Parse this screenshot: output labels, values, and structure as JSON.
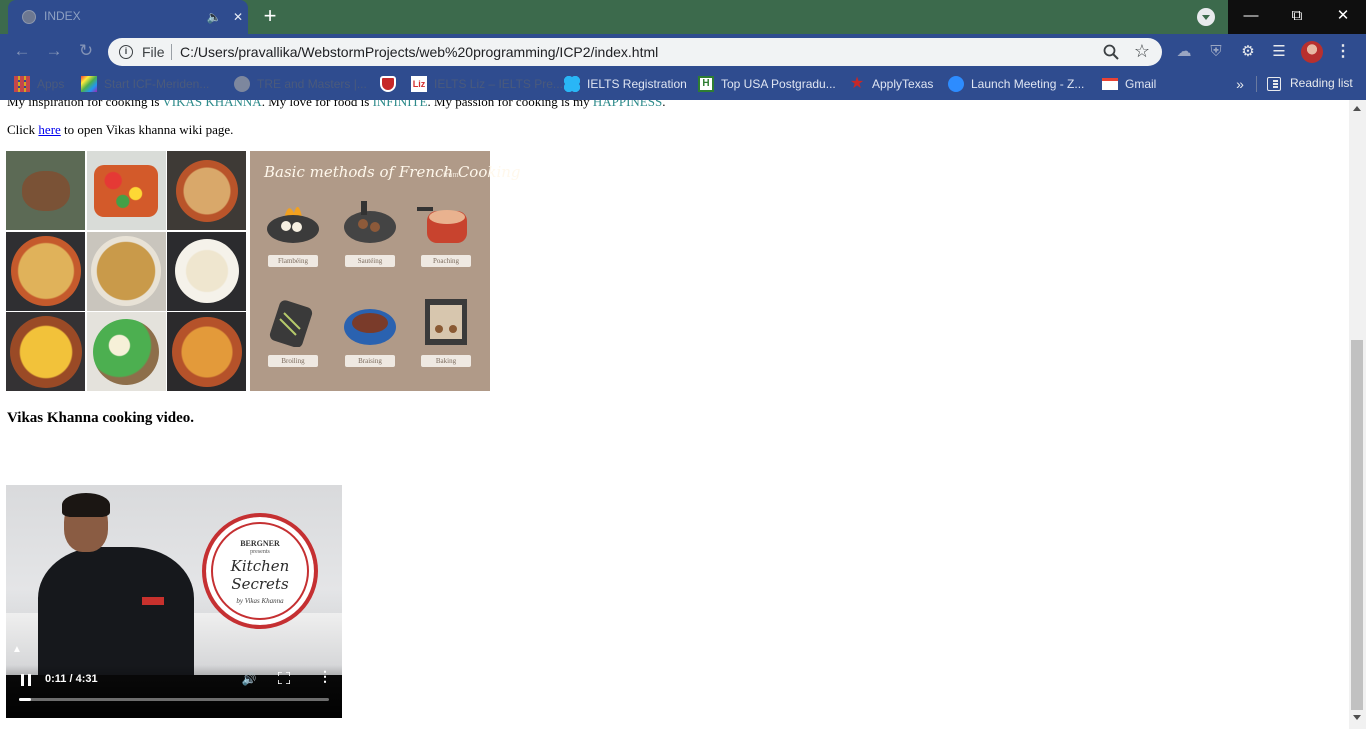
{
  "browser": {
    "tab": {
      "title": "INDEX"
    },
    "address": {
      "scheme_label": "File",
      "url": "C:/Users/pravallika/WebstormProjects/web%20programming/ICP2/index.html"
    },
    "bookmarks": [
      {
        "label": "Apps",
        "dim": true,
        "color": "#e8453c"
      },
      {
        "label": "Start ICF-Meriden...",
        "dim": true,
        "color": "#f4b400"
      },
      {
        "label": "TRE and Masters |...",
        "dim": true,
        "color": "#9aa0a6"
      },
      {
        "label": "",
        "dim": false,
        "color": "#c62828"
      },
      {
        "label": "IELTS Liz – IELTS Pre...",
        "dim": true,
        "color": "#d32f2f"
      },
      {
        "label": "IELTS Registration",
        "dim": false,
        "color": "#29b6f6"
      },
      {
        "label": "Top USA Postgradu...",
        "dim": false,
        "color": "#2e7d32"
      },
      {
        "label": "ApplyTexas",
        "dim": false,
        "color": "#c62828"
      },
      {
        "label": "Launch Meeting - Z...",
        "dim": false,
        "color": "#2d8cff"
      },
      {
        "label": "Gmail",
        "dim": false,
        "color": "#ea4335"
      }
    ],
    "reading_list": "Reading list"
  },
  "page": {
    "intro": {
      "prefix": "My inspiration for cooking is ",
      "person": "VIKAS KHANNA",
      "middle": ". My love for food is ",
      "love": "INFINITE",
      "middle2": ". My passion for cooking is my ",
      "passion": "HAPPINESS",
      "suffix": "."
    },
    "click_line": {
      "prefix": "Click ",
      "link": "here",
      "suffix": " to open Vikas khanna wiki page."
    },
    "french_image": {
      "title": "Basic methods of French Cooking",
      "from": "from",
      "methods": [
        "Flambéing",
        "Sautéing",
        "Poaching",
        "Broiling",
        "Braising",
        "Baking"
      ]
    },
    "video_heading": "Vikas Khanna cooking video.",
    "video": {
      "seal_brand": "BERGNER",
      "seal_presents": "presents",
      "seal_title_1": "Kitchen",
      "seal_title_2": "Secrets",
      "seal_by": "by Vikas Khanna",
      "time": "0:11 / 4:31",
      "progress": 0.04
    }
  }
}
